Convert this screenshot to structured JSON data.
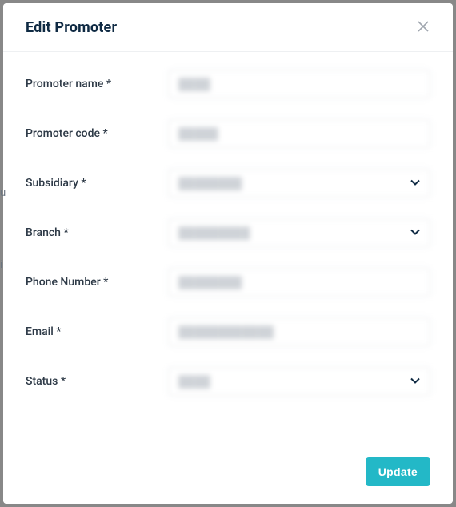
{
  "modal": {
    "title": "Edit Promoter",
    "submit_label": "Update"
  },
  "fields": {
    "promoter_name": {
      "label": "Promoter name *",
      "value": "████"
    },
    "promoter_code": {
      "label": "Promoter code *",
      "value": "█████"
    },
    "subsidiary": {
      "label": "Subsidiary *",
      "value": "████████"
    },
    "branch": {
      "label": "Branch *",
      "value": "█████████"
    },
    "phone": {
      "label": "Phone Number *",
      "value": "████████"
    },
    "email": {
      "label": "Email *",
      "value": "████████████"
    },
    "status": {
      "label": "Status *",
      "value": "████"
    }
  },
  "peek": {
    "u": "u",
    "i": "i"
  }
}
